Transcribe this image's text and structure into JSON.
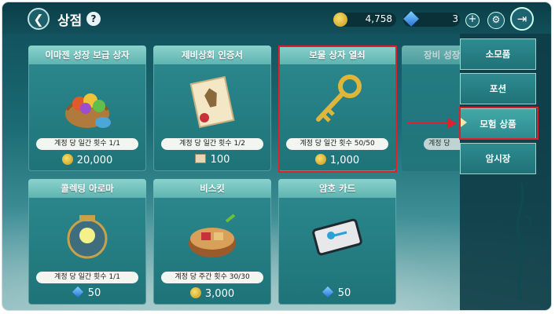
{
  "header": {
    "title": "상점",
    "help_label": "?",
    "gold_amount": "4,758",
    "gem_amount": "3",
    "plus_label": "+",
    "back_icon": "chevron-left-icon",
    "exit_icon": "exit-door-icon",
    "options_icon": "gear-icon"
  },
  "items": [
    {
      "name": "이마젠 성장 보급 상자",
      "limit": "계정 당 일간 횟수 1/1",
      "price": "20,000",
      "currency": "gold",
      "icon": "fruit-basket-icon"
    },
    {
      "name": "제비상회 인증서",
      "limit": "계정 당 일간 횟수 1/2",
      "price": "100",
      "currency": "ticket",
      "icon": "scroll-certificate-icon"
    },
    {
      "name": "보물 상자 열쇠",
      "limit": "계정 당 일간 횟수 50/50",
      "price": "1,000",
      "currency": "gold",
      "icon": "golden-key-icon"
    },
    {
      "name": "콜렉팅 아로마",
      "limit": "계정 당 일간 횟수 1/1",
      "price": "50",
      "currency": "gem",
      "icon": "aroma-jar-icon"
    },
    {
      "name": "비스킷",
      "limit": "계정 당 주간 횟수 30/30",
      "price": "3,000",
      "currency": "gold",
      "icon": "biscuit-box-icon"
    },
    {
      "name": "암호 카드",
      "limit": "",
      "price": "50",
      "currency": "gem",
      "icon": "key-card-icon"
    }
  ],
  "partial_item": {
    "name": "장비 성장",
    "limit": "계정 당"
  },
  "sidebar": {
    "items": [
      {
        "label": "소모품"
      },
      {
        "label": "포션"
      },
      {
        "label": "모험 상품"
      },
      {
        "label": "암시장"
      }
    ],
    "selected": "모험 상품"
  },
  "colors": {
    "highlight": "#e0202c",
    "accent": "#2c8a8f"
  }
}
